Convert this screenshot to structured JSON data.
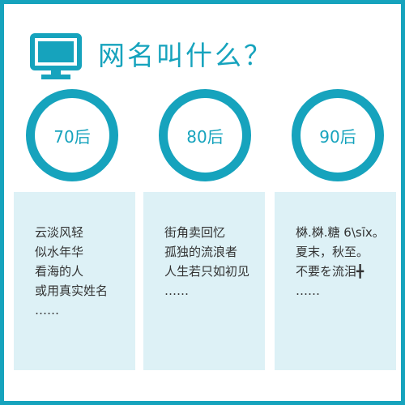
{
  "title": "网名叫什么？",
  "accent_color": "#16a3bd",
  "card_color": "#ddf1f6",
  "icon": "monitor-icon",
  "generations": [
    {
      "label": "70后",
      "lines": [
        "云淡风轻",
        "似水年华",
        "看海的人",
        "或用真实姓名",
        "……"
      ]
    },
    {
      "label": "80后",
      "lines": [
        "街角卖回忆",
        "孤独的流浪者",
        "人生若只如初见",
        "……"
      ]
    },
    {
      "label": "90后",
      "lines": [
        "棥.棥.糖 6\\sīx。",
        "夏末，秋至。",
        "不要を流泪╋",
        "……"
      ]
    }
  ]
}
